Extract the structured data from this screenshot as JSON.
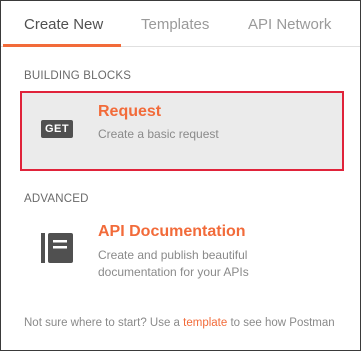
{
  "tabs": [
    {
      "label": "Create New",
      "active": true
    },
    {
      "label": "Templates",
      "active": false
    },
    {
      "label": "API Network",
      "active": false
    }
  ],
  "sections": {
    "building_blocks": "BUILDING BLOCKS",
    "advanced": "ADVANCED"
  },
  "request_card": {
    "badge": "GET",
    "title": "Request",
    "description": "Create a basic request"
  },
  "docs_card": {
    "icon": "api-documentation-icon",
    "title": "API Documentation",
    "description_line1": "Create and publish beautiful",
    "description_line2": "documentation for your APIs"
  },
  "footer": {
    "prefix": "Not sure where to start? Use a ",
    "link": "template",
    "suffix": " to see how Postman"
  },
  "colors": {
    "accent": "#f26b3a",
    "highlight_border": "#e0233a",
    "card_bg": "#ebebeb",
    "badge_bg": "#505050"
  }
}
